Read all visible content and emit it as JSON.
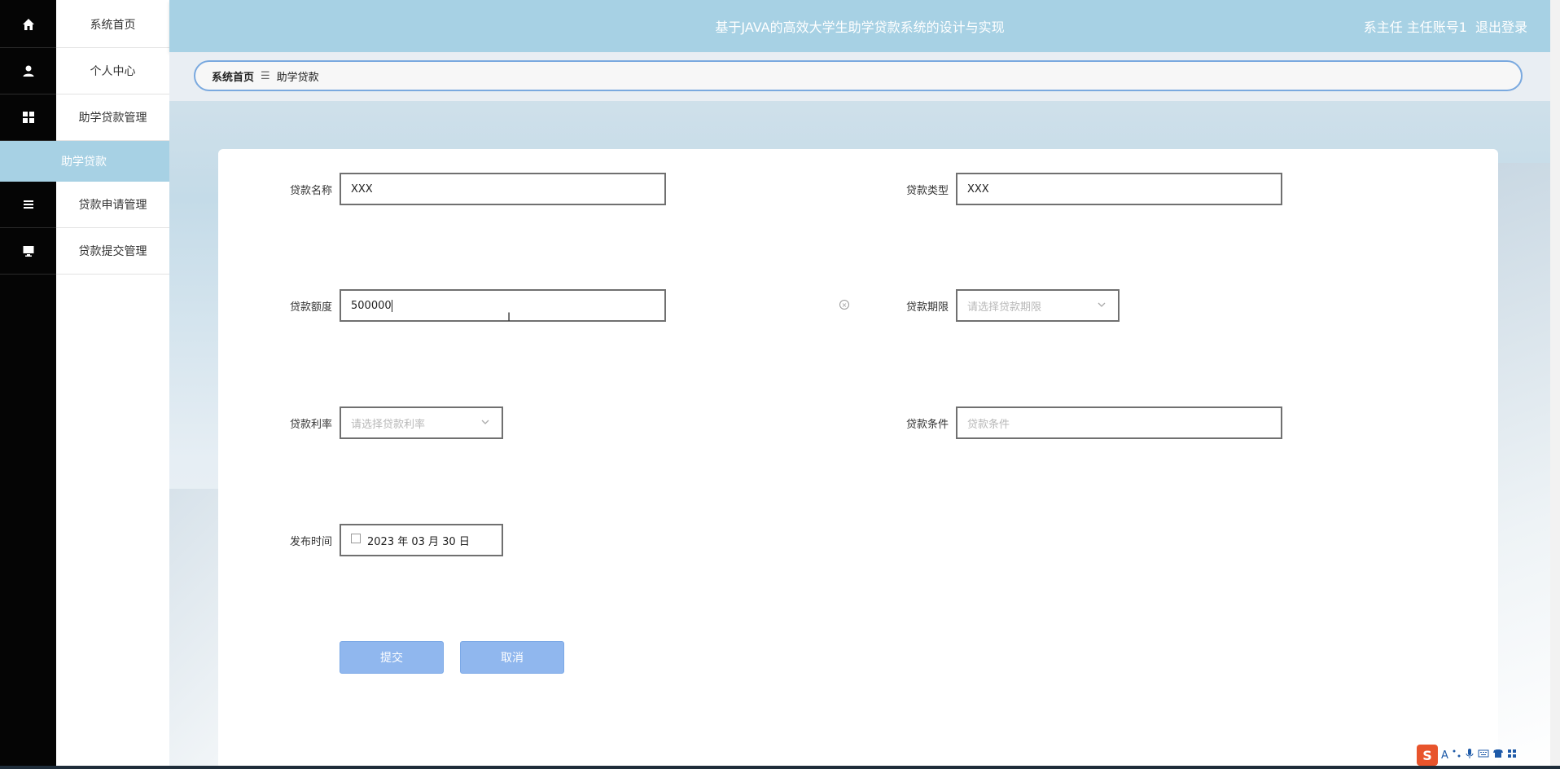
{
  "header": {
    "title": "基于JAVA的高效大学生助学贷款系统的设计与实现",
    "user_label": "系主任 主任账号1",
    "logout_label": "退出登录"
  },
  "sidebar": {
    "items": [
      {
        "label": "系统首页",
        "icon": "home-icon"
      },
      {
        "label": "个人中心",
        "icon": "user-icon"
      },
      {
        "label": "助学贷款管理",
        "icon": "grid-icon"
      },
      {
        "label": "贷款申请管理",
        "icon": "list-icon"
      },
      {
        "label": "贷款提交管理",
        "icon": "monitor-icon"
      }
    ],
    "active_sub": "助学贷款"
  },
  "breadcrumb": {
    "home": "系统首页",
    "separator": "☰",
    "current": "助学贷款"
  },
  "form": {
    "loan_name": {
      "label": "贷款名称",
      "value": "XXX"
    },
    "loan_type": {
      "label": "贷款类型",
      "value": "XXX"
    },
    "loan_amount": {
      "label": "贷款额度",
      "value": "500000"
    },
    "loan_term": {
      "label": "贷款期限",
      "placeholder": "请选择贷款期限"
    },
    "loan_rate": {
      "label": "贷款利率",
      "placeholder": "请选择贷款利率"
    },
    "loan_condition": {
      "label": "贷款条件",
      "placeholder": "贷款条件"
    },
    "publish_time": {
      "label": "发布时间",
      "value": "2023 年 03 月 30 日"
    }
  },
  "buttons": {
    "submit": "提交",
    "cancel": "取消"
  },
  "tray": {
    "ime_label": "S",
    "mode_label": "A"
  }
}
